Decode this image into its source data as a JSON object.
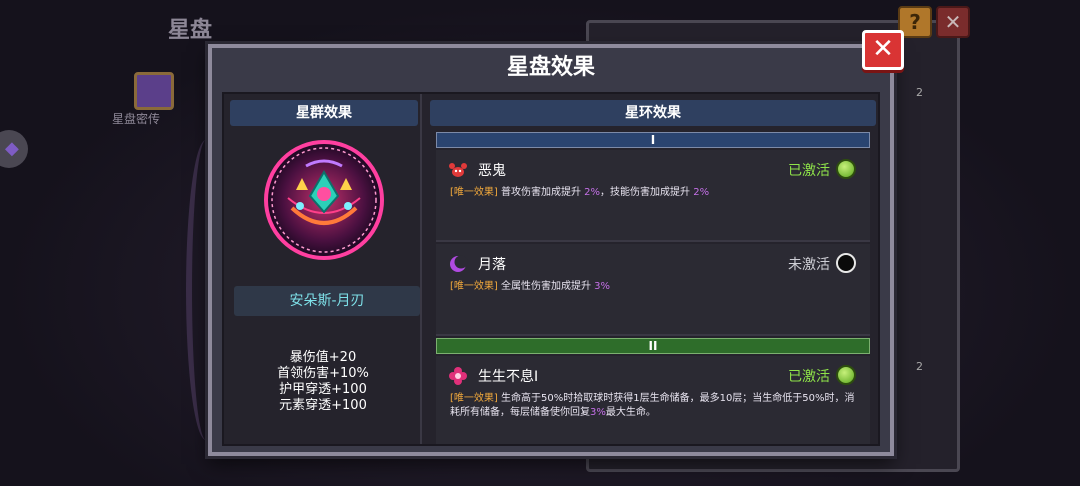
{
  "background": {
    "title": "星盘",
    "side_label": "星盘密传",
    "help_label": "?",
    "close_label": "✕",
    "count_1": "2",
    "count_2": "2"
  },
  "dialog": {
    "title": "星盘效果",
    "close_label": "✕",
    "left": {
      "header": "星群效果",
      "constellation_name": "安朵斯-月刃",
      "stats": [
        "暴伤值+20",
        "首领伤害+10%",
        "护甲穿透+100",
        "元素穿透+100"
      ]
    },
    "right": {
      "header": "星环效果",
      "tiers": [
        {
          "label": "I",
          "color": "#2a4470",
          "effects": [
            {
              "name": "恶鬼",
              "icon": "red-crab-icon",
              "status": "已激活",
              "active": true,
              "tag": "[唯一效果]",
              "desc_parts": [
                " 普攻伤害加成提升 ",
                "2%",
                "，技能伤害加成提升 ",
                "2%"
              ]
            },
            {
              "name": "月落",
              "icon": "purple-crescent-icon",
              "status": "未激活",
              "active": false,
              "tag": "[唯一效果]",
              "desc_parts": [
                " 全属性伤害加成提升 ",
                "3%"
              ]
            }
          ]
        },
        {
          "label": "II",
          "color": "#2e6d2a",
          "effects": [
            {
              "name": "生生不息Ⅰ",
              "icon": "pink-flower-icon",
              "status": "已激活",
              "active": true,
              "tag": "[唯一效果]",
              "desc_parts": [
                " 生命高于50%时拾取球时获得1层生命储备，最多10层；当生命低于50%时，消耗所有储备，每层储备使你回复",
                "3%",
                "最大生命。"
              ]
            }
          ]
        }
      ]
    }
  },
  "colors": {
    "accent_active": "#8fe34a",
    "highlight_value": "#c570e8",
    "tag_orange": "#f0a83c",
    "name_cyan": "#7ee0e8",
    "close_red": "#d93434"
  }
}
